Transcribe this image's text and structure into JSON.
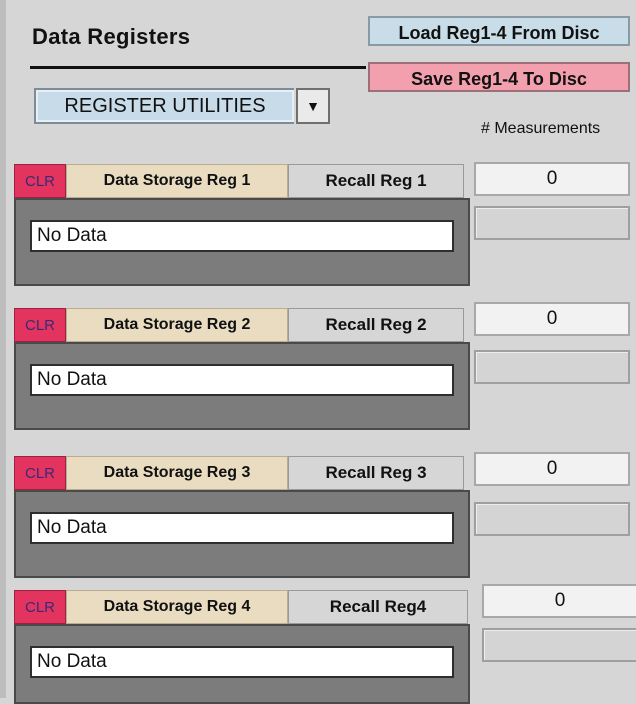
{
  "panel": {
    "title": "Data Registers",
    "load_button": "Load Reg1-4 From Disc",
    "save_button": "Save Reg1-4 To Disc",
    "utilities_dropdown": {
      "selected": "REGISTER UTILITIES",
      "arrow": "▼"
    },
    "measurements_label": "# Measurements"
  },
  "registers": [
    {
      "clr_label": "CLR",
      "storage_label": "Data Storage Reg 1",
      "recall_label": "Recall Reg 1",
      "value": "No Data",
      "measurements": "0"
    },
    {
      "clr_label": "CLR",
      "storage_label": "Data Storage Reg 2",
      "recall_label": "Recall Reg 2",
      "value": "No Data",
      "measurements": "0"
    },
    {
      "clr_label": "CLR",
      "storage_label": "Data Storage Reg 3",
      "recall_label": "Recall Reg 3",
      "value": "No Data",
      "measurements": "0"
    },
    {
      "clr_label": "CLR",
      "storage_label": "Data Storage Reg 4",
      "recall_label": "Recall Reg4",
      "value": "No Data",
      "measurements": "0"
    }
  ],
  "colors": {
    "background": "#d6d6d6",
    "clr_button": "#e2345f",
    "storage_button": "#e9dcc1",
    "load_button": "#c9dde8",
    "save_button": "#f3a0ae",
    "register_panel": "#7c7c7c"
  }
}
